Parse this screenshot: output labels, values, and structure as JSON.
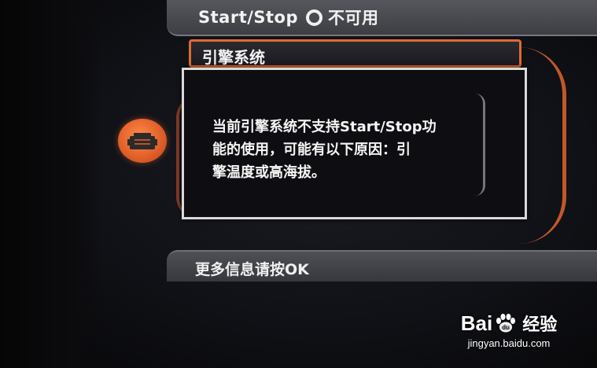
{
  "top_bar": {
    "label_prefix": "Start/Stop",
    "status_text": "不可用"
  },
  "menu": {
    "selected_item": "引擎系统"
  },
  "dialog": {
    "message_line1": "当前引擎系统不支持Start/Stop功",
    "message_line2": "能的使用，可能有以下原因：引",
    "message_line3": "擎温度或高海拔。"
  },
  "bottom_bar": {
    "hint": "更多信息请按OK"
  },
  "watermark": {
    "logo_left": "Bai",
    "logo_right": "经验",
    "url": "jingyan.baidu.com"
  },
  "colors": {
    "accent_orange": "#e06a32",
    "bar_gray": "#4e5056",
    "text_white": "#f3f3f3"
  },
  "icons": {
    "engine": "engine-icon",
    "status": "circle-icon"
  }
}
